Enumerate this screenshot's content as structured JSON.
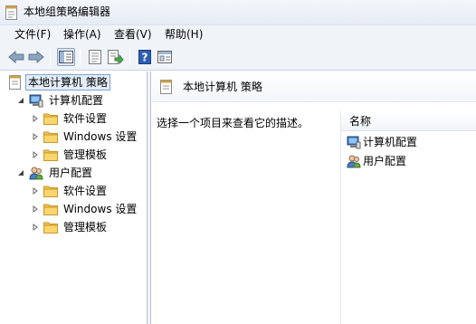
{
  "window": {
    "title": "本地组策略编辑器",
    "icon": "policy-document-icon"
  },
  "menu": [
    {
      "label": "文件(F)"
    },
    {
      "label": "操作(A)"
    },
    {
      "label": "查看(V)"
    },
    {
      "label": "帮助(H)"
    }
  ],
  "toolbar": {
    "buttons": [
      "back-arrow-icon",
      "forward-arrow-icon",
      "show-hide-tree-icon",
      "properties-icon",
      "export-list-icon",
      "help-icon",
      "extended-view-icon"
    ]
  },
  "tree": {
    "root": {
      "label": "本地计算机 策略",
      "icon": "policy-document-icon"
    },
    "computer_config": {
      "label": "计算机配置",
      "icon": "computer-icon"
    },
    "computer_children": [
      {
        "label": "软件设置"
      },
      {
        "label": "Windows 设置"
      },
      {
        "label": "管理模板"
      }
    ],
    "user_config": {
      "label": "用户配置",
      "icon": "users-icon"
    },
    "user_children": [
      {
        "label": "软件设置"
      },
      {
        "label": "Windows 设置"
      },
      {
        "label": "管理模板"
      }
    ]
  },
  "detail": {
    "header_title": "本地计算机 策略",
    "description": "选择一个项目来查看它的描述。",
    "column_header": "名称",
    "items": [
      {
        "label": "计算机配置",
        "icon": "computer-icon"
      },
      {
        "label": "用户配置",
        "icon": "users-icon"
      }
    ]
  },
  "colors": {
    "selection_border": "#7da2ce",
    "selection_fill": "#e3edf9",
    "folder": "#f3c54f",
    "help_blue": "#2b5fb4"
  }
}
